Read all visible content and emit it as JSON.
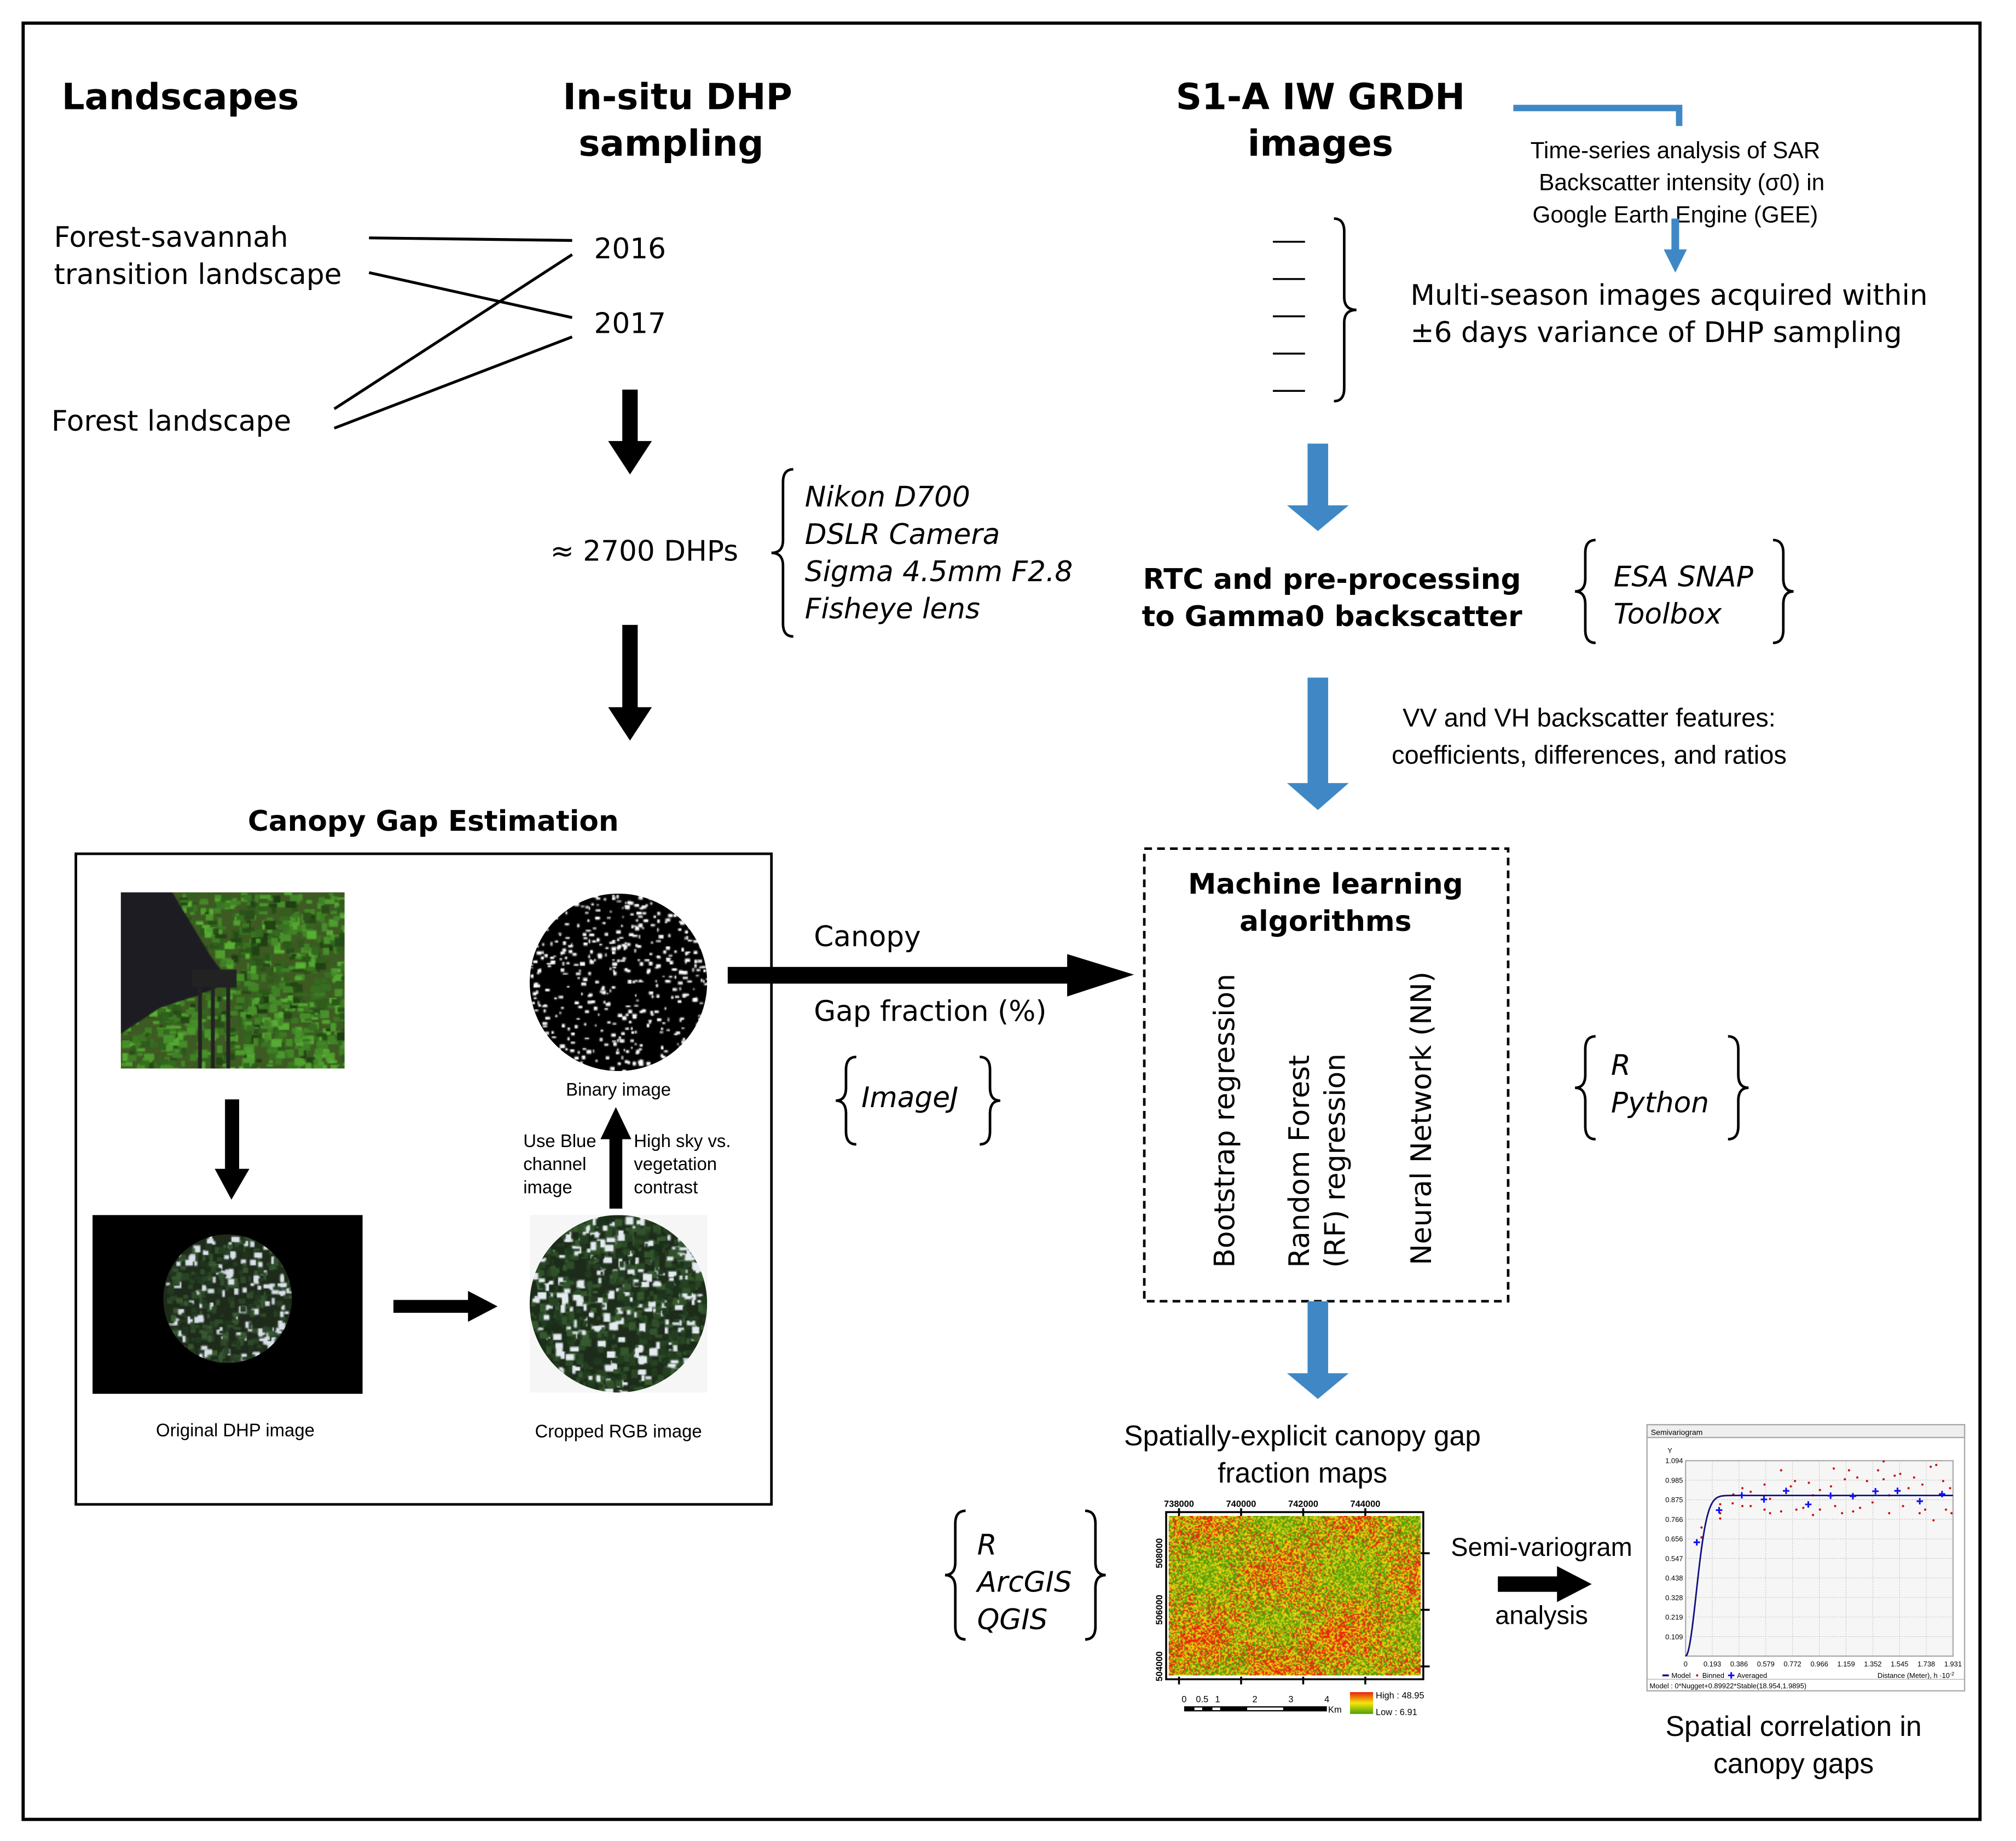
{
  "colors": {
    "accent_blue": "#3f88c5",
    "binned": "#d01010",
    "averaged": "#1010ee",
    "model": "#101080"
  },
  "headers": {
    "landscapes": "Landscapes",
    "insitu": [
      "In-situ DHP",
      "sampling"
    ],
    "s1": [
      "S1-A IW GRDH",
      "images"
    ]
  },
  "gee_note": [
    "Time-series analysis of SAR",
    "Backscatter intensity (σ0) in",
    "Google Earth Engine (GEE)"
  ],
  "landscapes": {
    "forest_savannah": [
      "Forest-savannah",
      "transition landscape"
    ],
    "forest": "Forest landscape"
  },
  "years": [
    "2016",
    "2017"
  ],
  "dhp_count": "≈ 2700 DHPs",
  "camera": [
    "Nikon D700",
    "DSLR Camera",
    "Sigma 4.5mm F2.8",
    "Fisheye lens"
  ],
  "multiseason": [
    "Multi-season images acquired within",
    "±6 days variance of DHP sampling"
  ],
  "rtc": [
    "RTC and pre-processing",
    "to Gamma0 backscatter"
  ],
  "snap": [
    "ESA SNAP",
    "Toolbox"
  ],
  "features": [
    "VV and VH backscatter features:",
    "coefficients, differences, and ratios"
  ],
  "canopy": {
    "title": "Canopy Gap Estimation",
    "original": "Original DHP image",
    "cropped": "Cropped RGB image",
    "binary": "Binary image",
    "blue_channel": [
      "Use Blue",
      "channel",
      "image"
    ],
    "contrast": [
      "High sky vs.",
      "vegetation",
      "contrast"
    ]
  },
  "gap_fraction": [
    "Canopy",
    "Gap fraction (%)"
  ],
  "imagej": "ImageJ",
  "ml": {
    "title": [
      "Machine learning",
      "algorithms"
    ],
    "algorithms": [
      "Bootstrap regression",
      "Random Forest",
      "(RF) regression",
      "Neural Network (NN)"
    ]
  },
  "r_python": [
    "R",
    "Python"
  ],
  "maps_title": [
    "Spatially-explicit canopy gap",
    "fraction maps"
  ],
  "gis": [
    "R",
    "ArcGIS",
    "QGIS"
  ],
  "map": {
    "x_ticks": [
      "738000",
      "740000",
      "742000",
      "744000"
    ],
    "y_ticks": [
      "508000",
      "506000",
      "504000"
    ],
    "scale_labels": [
      "0",
      "0.5",
      "1",
      "2",
      "3",
      "4"
    ],
    "scale_unit": "Km",
    "legend_high": "High : 48.95",
    "legend_low": "Low : 6.91",
    "colors": [
      "#e8200c",
      "#f5e60a",
      "#4ea00a"
    ]
  },
  "semivariogram_label": [
    "Semi-variogram",
    "analysis"
  ],
  "spatial": [
    "Spatial correlation in",
    "canopy gaps"
  ],
  "chart_data": {
    "type": "scatter",
    "title": "Semivariogram",
    "ylabel": "Y",
    "xlabel": "Distance (Meter), h ·10",
    "xlabel_exp": "-2",
    "xlim": [
      0,
      1.931
    ],
    "ylim": [
      0,
      1.094
    ],
    "x_ticks": [
      "0",
      "0.193",
      "0.386",
      "0.579",
      "0.772",
      "0.966",
      "1.159",
      "1.352",
      "1.545",
      "1.738",
      "1.931"
    ],
    "y_ticks": [
      "0.109",
      "0.219",
      "0.328",
      "0.438",
      "0.547",
      "0.656",
      "0.766",
      "0.875",
      "0.985",
      "1.094"
    ],
    "grid": true,
    "legend": [
      "Model",
      "Binned",
      "Averaged"
    ],
    "legend_placement": "bottom-left",
    "model_text": "Model : 0*Nugget+0.89922*Stable(18.954,1.9895)",
    "model": {
      "nugget": 0,
      "sill": 0.89922,
      "range": 0.18954,
      "shape": 1.9895
    },
    "averaged": [
      [
        0.081,
        0.637
      ],
      [
        0.242,
        0.817
      ],
      [
        0.406,
        0.9
      ],
      [
        0.566,
        0.877
      ],
      [
        0.726,
        0.925
      ],
      [
        0.886,
        0.849
      ],
      [
        1.047,
        0.898
      ],
      [
        1.208,
        0.895
      ],
      [
        1.371,
        0.923
      ],
      [
        1.53,
        0.925
      ],
      [
        1.691,
        0.867
      ],
      [
        1.852,
        0.907
      ]
    ],
    "binned": [
      [
        0.115,
        0.72
      ],
      [
        0.115,
        0.665
      ],
      [
        0.25,
        0.85
      ],
      [
        0.25,
        0.8
      ],
      [
        0.25,
        0.77
      ],
      [
        0.34,
        0.855
      ],
      [
        0.345,
        0.905
      ],
      [
        0.41,
        0.94
      ],
      [
        0.41,
        0.84
      ],
      [
        0.47,
        0.92
      ],
      [
        0.47,
        0.84
      ],
      [
        0.57,
        0.96
      ],
      [
        0.57,
        0.82
      ],
      [
        0.61,
        0.88
      ],
      [
        0.61,
        0.8
      ],
      [
        0.69,
        1.04
      ],
      [
        0.69,
        0.81
      ],
      [
        0.76,
        0.95
      ],
      [
        0.79,
        0.98
      ],
      [
        0.8,
        0.82
      ],
      [
        0.85,
        0.83
      ],
      [
        0.89,
        0.97
      ],
      [
        0.92,
        0.79
      ],
      [
        0.92,
        0.9
      ],
      [
        0.97,
        0.93
      ],
      [
        0.97,
        0.82
      ],
      [
        1.05,
        0.95
      ],
      [
        1.07,
        1.05
      ],
      [
        1.08,
        0.84
      ],
      [
        1.13,
        0.8
      ],
      [
        1.15,
        0.99
      ],
      [
        1.18,
        1.04
      ],
      [
        1.21,
        0.81
      ],
      [
        1.24,
        1.0
      ],
      [
        1.26,
        0.83
      ],
      [
        1.31,
        0.98
      ],
      [
        1.35,
        0.86
      ],
      [
        1.39,
        1.04
      ],
      [
        1.43,
        1.09
      ],
      [
        1.43,
        0.99
      ],
      [
        1.47,
        0.9
      ],
      [
        1.47,
        0.8
      ],
      [
        1.51,
        1.01
      ],
      [
        1.55,
        1.02
      ],
      [
        1.57,
        0.84
      ],
      [
        1.61,
        0.94
      ],
      [
        1.65,
        1.0
      ],
      [
        1.69,
        0.8
      ],
      [
        1.71,
        0.96
      ],
      [
        1.73,
        0.82
      ],
      [
        1.77,
        1.06
      ],
      [
        1.79,
        0.76
      ],
      [
        1.81,
        1.07
      ],
      [
        1.86,
        0.98
      ],
      [
        1.88,
        0.82
      ],
      [
        1.91,
        0.94
      ],
      [
        1.92,
        0.8
      ]
    ]
  }
}
